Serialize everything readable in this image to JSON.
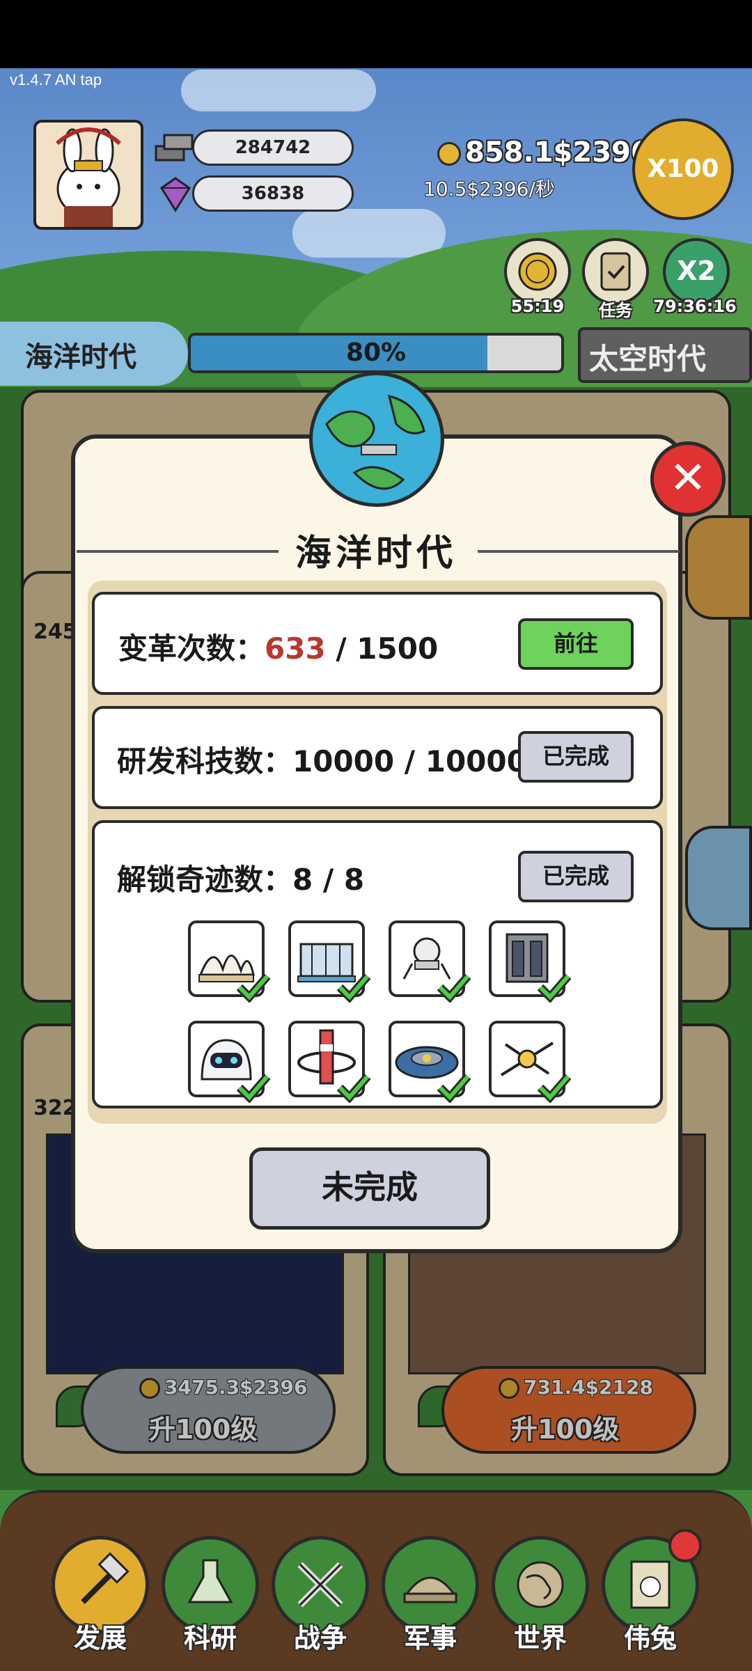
{
  "status": {
    "version": "v1.4.7 AN tap"
  },
  "player": {
    "iron": "284742",
    "gems": "36838",
    "money": "858.1$2396",
    "rate": "10.5$2396/秒"
  },
  "boosts": {
    "x100_label": "X100",
    "coin_timer": "55:19",
    "task_label": "任务",
    "x2_label": "X2",
    "x2_timer": "79:36:16"
  },
  "era": {
    "current": "海洋时代",
    "next": "太空时代",
    "progress_text": "80%",
    "progress": 0.8
  },
  "background_cards": {
    "left_cost": "3475.3$2396",
    "left_label": "升100级",
    "right_cost": "731.4$2128",
    "right_label": "升100级",
    "left_partial_1": "245",
    "left_partial_2": "322"
  },
  "dialog": {
    "title": "海洋时代",
    "requirements": [
      {
        "label": "变革次数：",
        "current": "633",
        "total": "/ 1500",
        "button": "前往"
      },
      {
        "label": "研发科技数：",
        "current": "10000",
        "total": "/ 10000",
        "button": "已完成"
      },
      {
        "label": "解锁奇迹数：",
        "current": "8",
        "total": "/ 8",
        "button": "已完成"
      }
    ],
    "wonders": [
      "opera-house",
      "museum",
      "lunar-lander",
      "skyscraper",
      "robot",
      "space-station",
      "ufo",
      "satellite"
    ],
    "action_button": "未完成"
  },
  "nav": {
    "items": [
      "发展",
      "科研",
      "战争",
      "军事",
      "世界",
      "伟兔"
    ]
  },
  "colors": {
    "accent_gold": "#e2ad2e",
    "progress_blue": "#3a8ec2",
    "go_green": "#6ed35a",
    "close_red": "#e03232",
    "highlight_red": "#b8392c"
  }
}
